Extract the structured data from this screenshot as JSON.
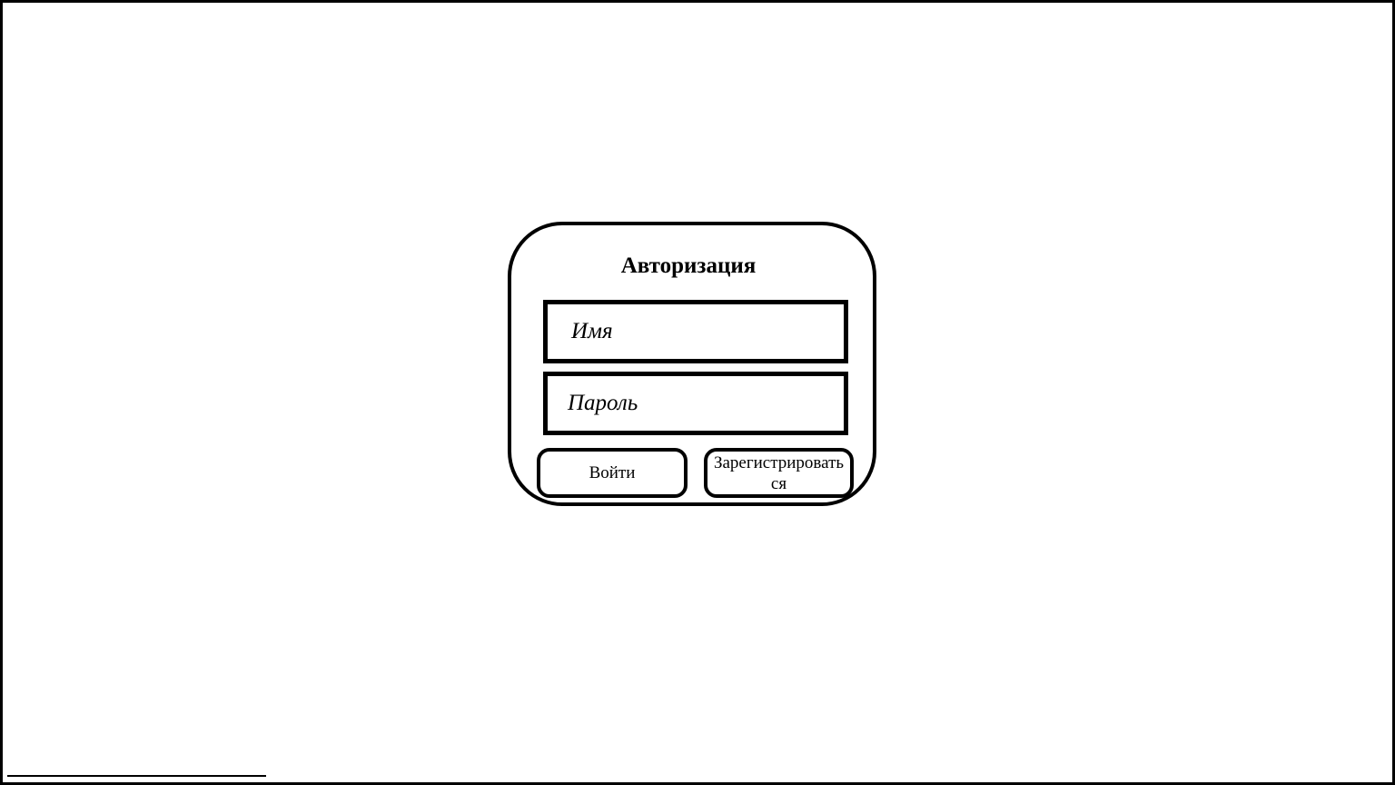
{
  "auth_form": {
    "title": "Авторизация",
    "name_placeholder": "Имя",
    "password_placeholder": "Пароль",
    "login_button_label": "Войти",
    "register_button_label": "Зарегистрироваться"
  },
  "colors": {
    "background": "#ffffff",
    "stroke": "#000000",
    "text": "#000000"
  }
}
